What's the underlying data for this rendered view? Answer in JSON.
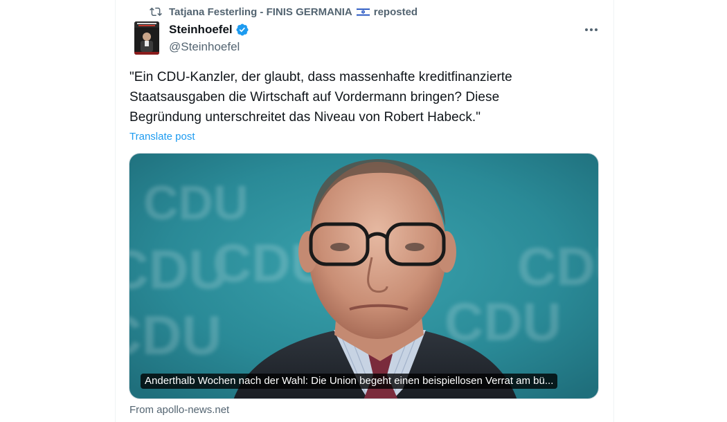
{
  "repost": {
    "reposter_name": "Tatjana Festerling - FINIS GERMANIA",
    "label": "reposted",
    "icon": "repost-icon"
  },
  "author": {
    "display_name": "Steinhoefel",
    "handle": "@Steinhoefel",
    "verified": true,
    "verified_color": "#1d9bf0"
  },
  "post": {
    "text": "\"Ein CDU-Kanzler, der glaubt, dass massenhafte kreditfinanzierte\nStaatsausgaben die Wirtschaft auf Vordermann bringen? Diese\nBegründung unterschreitet das Niveau von Robert Habeck.\"",
    "translate_label": "Translate post"
  },
  "link_card": {
    "caption": "Anderthalb Wochen nach der Wahl: Die Union begeht einen beispiellosen Verrat am bü...",
    "source": "From apollo-news.net",
    "backdrop_text": "CDU"
  },
  "colors": {
    "accent": "#1d9bf0",
    "text_primary": "#0f1419",
    "text_secondary": "#536471",
    "photo_backdrop": "#2e8f9b"
  }
}
